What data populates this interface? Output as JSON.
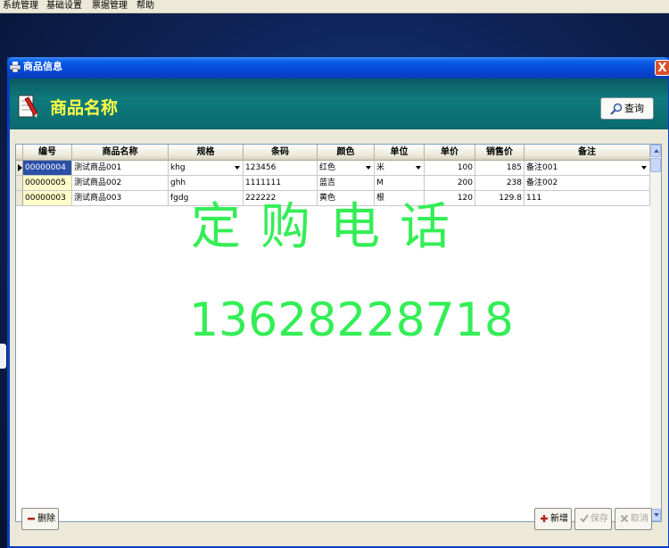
{
  "menubar": {
    "items": [
      "系统管理",
      "基础设置",
      "票据管理",
      "帮助"
    ]
  },
  "window": {
    "title": "商品信息",
    "close_label": "X"
  },
  "header": {
    "title": "商品名称",
    "query_label": "查询"
  },
  "grid": {
    "columns": [
      "编号",
      "商品名称",
      "规格",
      "条码",
      "颜色",
      "单位",
      "单价",
      "销售价",
      "备注"
    ],
    "rows": [
      {
        "code": "00000004",
        "name": "测试商品001",
        "spec": "khg",
        "barcode": "123456",
        "color": "红色",
        "unit": "米",
        "price": "100",
        "sale_price": "185",
        "note": "备注001",
        "selected": true
      },
      {
        "code": "00000005",
        "name": "测试商品002",
        "spec": "ghh",
        "barcode": "1111111",
        "color": "蓝吉",
        "unit": "M",
        "price": "200",
        "sale_price": "238",
        "note": "备注002",
        "selected": false
      },
      {
        "code": "00000003",
        "name": "测试商品003",
        "spec": "fgdg",
        "barcode": "222222",
        "color": "黄色",
        "unit": "根",
        "price": "120",
        "sale_price": "129.8",
        "note": "111",
        "selected": false
      }
    ]
  },
  "watermark": {
    "title": "定购电话",
    "phone": "13628228718"
  },
  "buttons": {
    "delete": "删除",
    "add": "新增",
    "save": "保存",
    "cancel": "取消"
  },
  "colors": {
    "watermark": "#33ee55",
    "header_band": "#0e7a7d",
    "header_title": "#ffff44",
    "selected_cell": "#2a50a8",
    "code_cell": "#fffdc9"
  }
}
